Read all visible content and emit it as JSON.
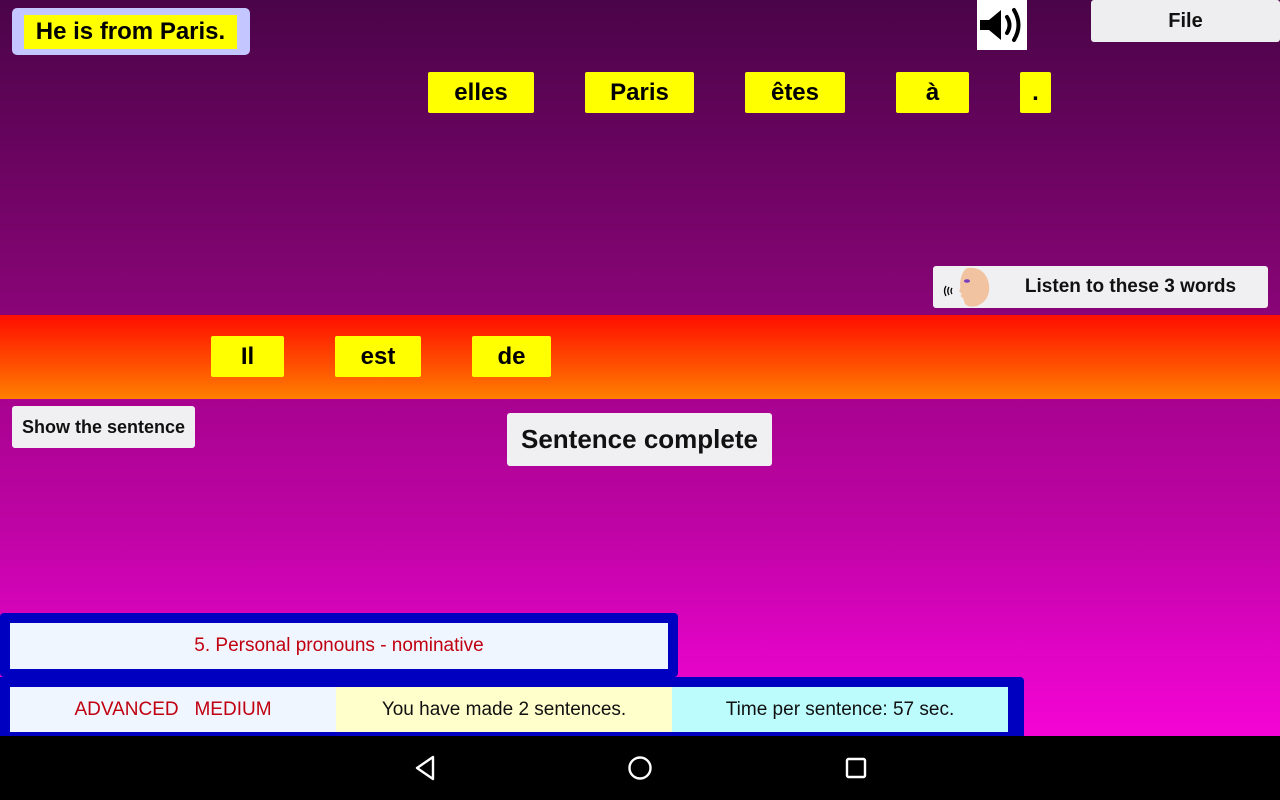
{
  "target_sentence": "He is from Paris.",
  "toolbar": {
    "sound_icon": "speaker-icon",
    "file_label": "File"
  },
  "word_bank": [
    {
      "text": "elles"
    },
    {
      "text": "Paris"
    },
    {
      "text": "êtes"
    },
    {
      "text": "à"
    },
    {
      "text": "."
    }
  ],
  "listen_button": {
    "label": "Listen to these 3 words",
    "icon": "speaking-face-icon"
  },
  "answer_words": [
    {
      "text": "Il"
    },
    {
      "text": "est"
    },
    {
      "text": "de"
    }
  ],
  "buttons": {
    "show_sentence": "Show the sentence",
    "sentence_complete": "Sentence complete"
  },
  "status": {
    "topic": "5. Personal pronouns - nominative",
    "level": "ADVANCED   MEDIUM",
    "sentences_made": "You have made 2 sentences.",
    "time_per_sentence": "Time per sentence: 57 sec."
  },
  "navbar": {
    "back_icon": "back-triangle-icon",
    "home_icon": "home-circle-icon",
    "recents_icon": "recents-square-icon"
  },
  "colors": {
    "word_tile": "#ffff00",
    "status_frame": "#0000c0",
    "topic_text": "#c00010"
  }
}
